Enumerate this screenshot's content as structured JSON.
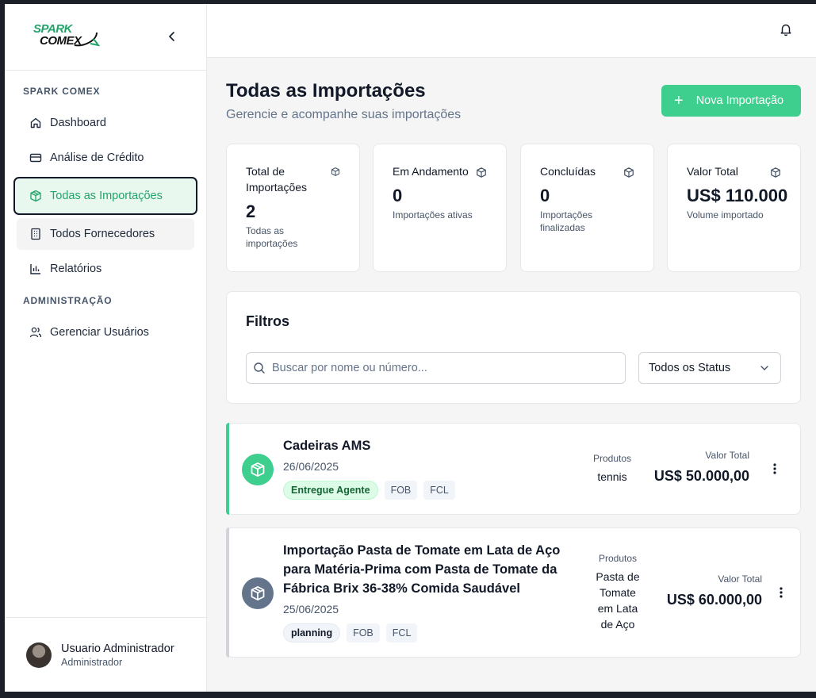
{
  "brand": {
    "logo_line1": "SPARK",
    "logo_line2": "COMEX"
  },
  "sidebar": {
    "section1": "SPARK COMEX",
    "items": [
      {
        "label": "Dashboard",
        "icon": "home-icon"
      },
      {
        "label": "Análise de Crédito",
        "icon": "credit-card-icon"
      },
      {
        "label": "Todas as Importações",
        "icon": "package-icon"
      },
      {
        "label": "Todos Fornecedores",
        "icon": "building-icon"
      },
      {
        "label": "Relatórios",
        "icon": "bar-chart-icon"
      }
    ],
    "section2": "ADMINISTRAÇÃO",
    "admin_items": [
      {
        "label": "Gerenciar Usuários",
        "icon": "users-icon"
      }
    ],
    "user": {
      "name": "Usuario Administrador",
      "role": "Administrador"
    }
  },
  "header": {
    "title": "Todas as Importações",
    "subtitle": "Gerencie e acompanhe suas importações",
    "new_button": "Nova Importação"
  },
  "stats": [
    {
      "title": "Total de Importações",
      "value": "2",
      "desc": "Todas as importações"
    },
    {
      "title": "Em Andamento",
      "value": "0",
      "desc": "Importações ativas"
    },
    {
      "title": "Concluídas",
      "value": "0",
      "desc": "Importações finalizadas"
    },
    {
      "title": "Valor Total",
      "value": "US$ 110.000",
      "desc": "Volume importado"
    }
  ],
  "filters": {
    "title": "Filtros",
    "search_placeholder": "Buscar por nome ou número...",
    "status_selected": "Todos os Status"
  },
  "imports": [
    {
      "name": "Cadeiras AMS",
      "date": "26/06/2025",
      "status": "Entregue Agente",
      "incoterm": "FOB",
      "container": "FCL",
      "products_label": "Produtos",
      "products": "tennis",
      "value_label": "Valor Total",
      "value": "US$ 50.000,00",
      "accent": "#3ecf8e"
    },
    {
      "name": "Importação Pasta de Tomate em Lata de Aço para Matéria-Prima com Pasta de Tomate da Fábrica Brix 36-38% Comida Saudável",
      "date": "25/06/2025",
      "status": "planning",
      "incoterm": "FOB",
      "container": "FCL",
      "products_label": "Produtos",
      "products": "Pasta de Tomate em Lata de Aço",
      "value_label": "Valor Total",
      "value": "US$ 60.000,00",
      "accent": "#d1d5db"
    }
  ]
}
